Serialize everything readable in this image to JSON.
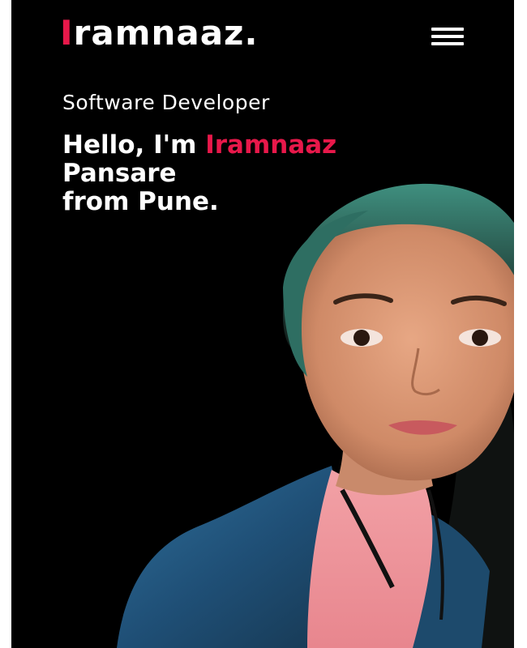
{
  "header": {
    "logo_initial": "I",
    "logo_rest": "ramnaaz."
  },
  "hero": {
    "subtitle": "Software Developer",
    "greeting": "Hello, I'm ",
    "highlight_name": "Iramnaaz",
    "line2": "Pansare",
    "line3": "from Pune."
  },
  "colors": {
    "background": "#000000",
    "accent": "#e8184a",
    "text": "#ffffff"
  },
  "icons": {
    "menu": "hamburger-menu-icon"
  }
}
